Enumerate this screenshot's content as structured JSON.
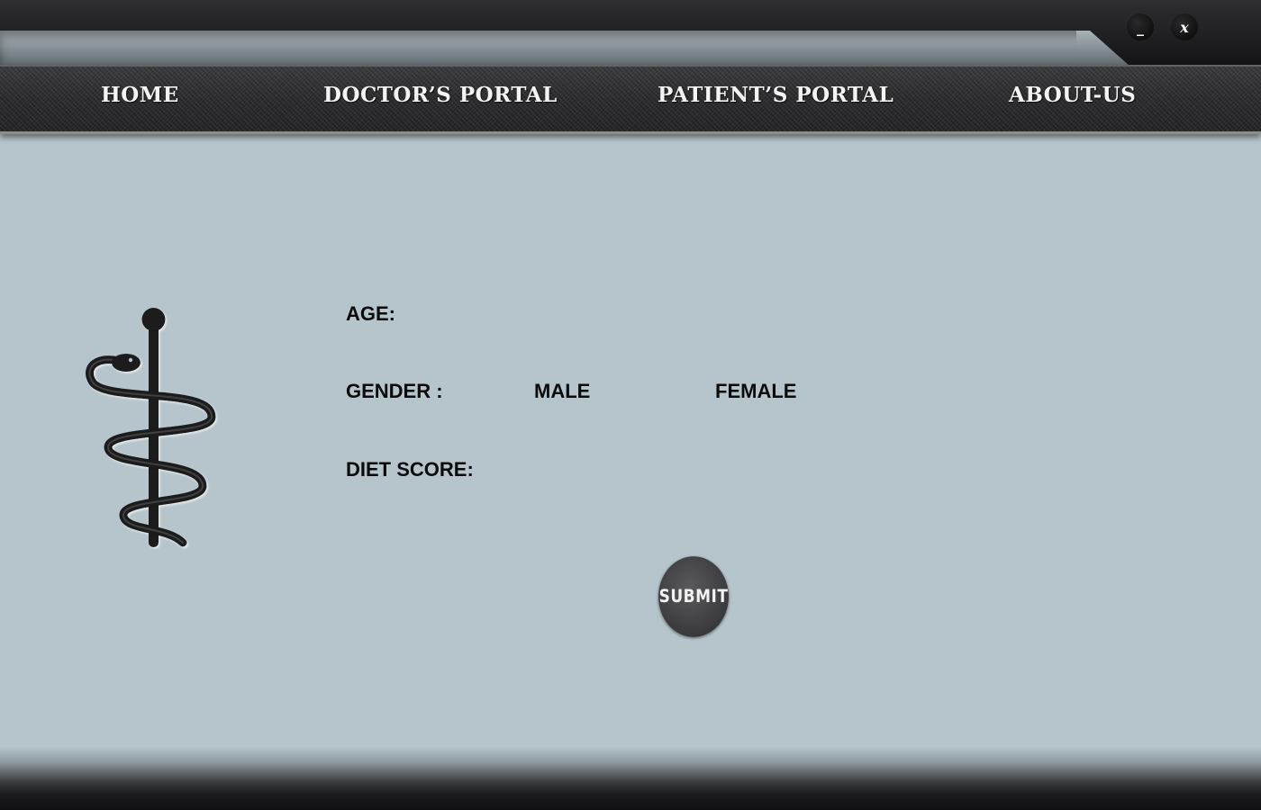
{
  "window": {
    "minimize_label": "_",
    "close_label": "x"
  },
  "nav": {
    "home": "HOME",
    "doctor_portal": "DOCTOR’S PORTAL",
    "patient_portal": "PATIENT’S PORTAL",
    "about_us": "ABOUT-US"
  },
  "form": {
    "age_label": "AGE:",
    "gender_label": "GENDER :",
    "gender_options": [
      "MALE",
      "FEMALE"
    ],
    "diet_score_label": "DIET SCORE:",
    "submit_label": "SUBMIT"
  },
  "logo": {
    "icon": "rod-of-asclepius-icon"
  },
  "colors": {
    "background": "#b6c5cc",
    "nav_background": "#2a2a2c",
    "nav_text": "#f4f4f4",
    "label_text": "#0b0b0b",
    "submit_background": "#444446"
  }
}
